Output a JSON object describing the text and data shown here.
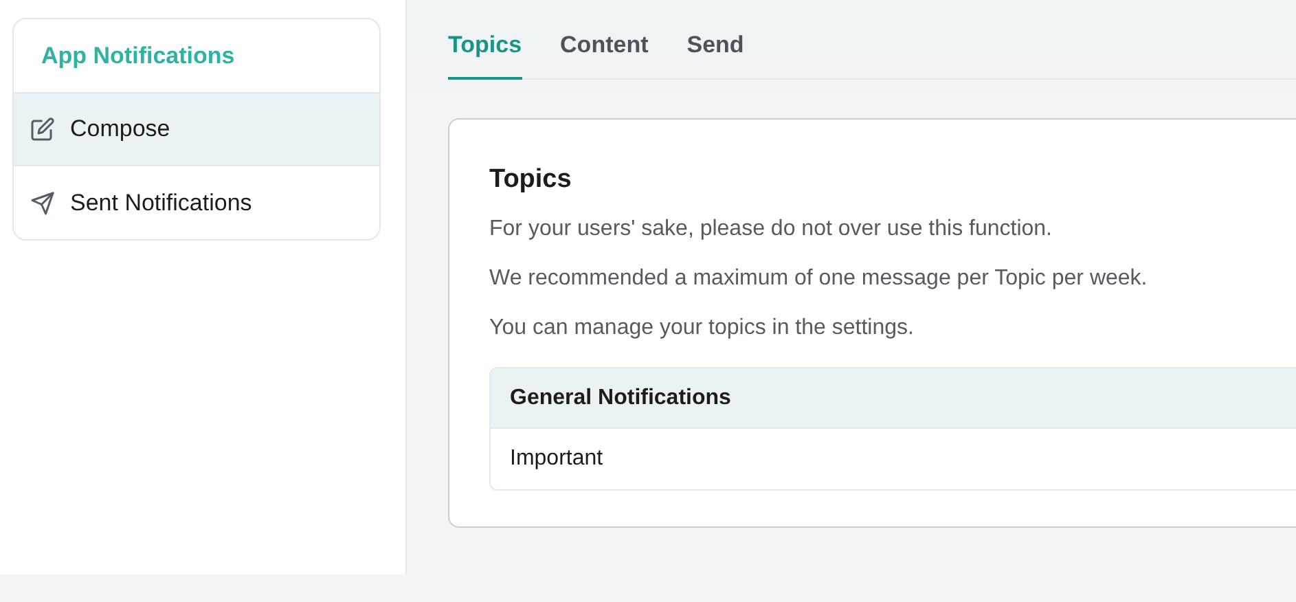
{
  "sidebar": {
    "title": "App Notifications",
    "items": [
      {
        "label": "Compose",
        "kind": "compose",
        "selected": true
      },
      {
        "label": "Sent Notifications",
        "kind": "sent",
        "selected": false
      }
    ]
  },
  "tabs": [
    {
      "label": "Topics",
      "selected": true
    },
    {
      "label": "Content",
      "selected": false
    },
    {
      "label": "Send",
      "selected": false
    }
  ],
  "panel": {
    "title": "Topics",
    "paragraphs": [
      "For your users' sake, please do not over use this function.",
      "We recommended a maximum of one message per Topic per week.",
      "You can manage your topics in the settings."
    ],
    "topics": [
      {
        "label": "General Notifications",
        "selected": true
      },
      {
        "label": "Important",
        "selected": false
      }
    ]
  }
}
